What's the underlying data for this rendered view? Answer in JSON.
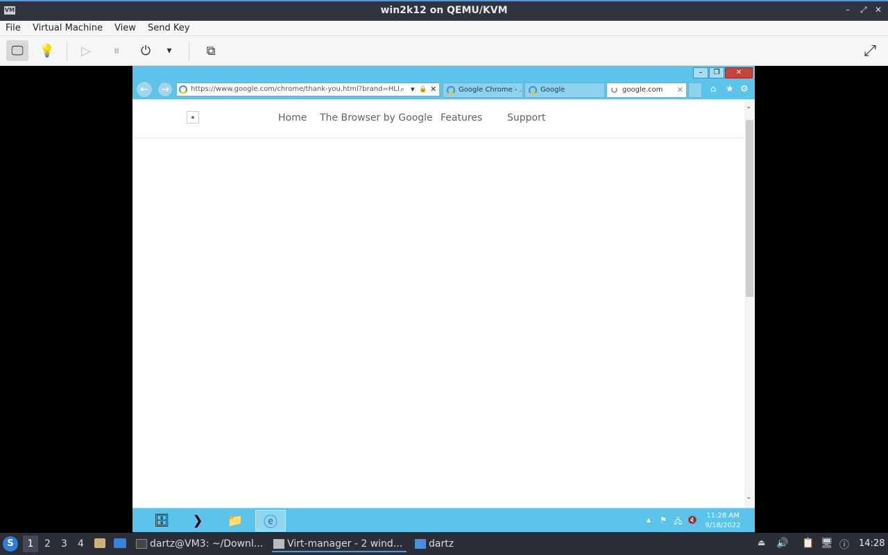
{
  "window": {
    "title": "win2k12 on QEMU/KVM",
    "controls": {
      "minimize": "–",
      "restore": "⤢",
      "close": "✕"
    }
  },
  "menu": {
    "file": "File",
    "vm": "Virtual Machine",
    "view": "View",
    "send_key": "Send Key"
  },
  "toolbar": {
    "console": "🖵",
    "details": "💡",
    "run": "▷",
    "pause": "⏸",
    "power": "⏻",
    "power_menu": "▾",
    "snapshots": "⧉",
    "fullscreen": "⤢"
  },
  "ie": {
    "caption": {
      "minimize": "–",
      "restore": "❐",
      "close": "✕"
    },
    "back": "←",
    "forward": "→",
    "address_url": "https://www.google.com/chrome/thank-you.html?brand=HLDY",
    "address_icons": {
      "search": "⌕",
      "dropdown": "▾",
      "lock": "🔒",
      "stop": "✕"
    },
    "tabs": [
      {
        "label": "Google Chrome - ..."
      },
      {
        "label": "Google"
      },
      {
        "label": "google.com",
        "close": "✕"
      }
    ],
    "right_icons": {
      "home": "⌂",
      "favorites": "★",
      "tools": "⚙"
    }
  },
  "site": {
    "logo": "▪",
    "nav": [
      "Home",
      "The Browser by Google",
      "Features",
      "Support"
    ]
  },
  "scrollbar": {
    "up": "⌃",
    "down": "⌄"
  },
  "win_taskbar": {
    "apps": {
      "server_manager": "🗄",
      "powershell": "❯",
      "explorer": "📁",
      "ie": "ⓔ"
    },
    "tray": {
      "up": "▲",
      "flag": "⚑",
      "network": "🖧",
      "volume": "🔇"
    },
    "time": "11:28 AM",
    "date": "9/18/2022"
  },
  "host_panel": {
    "workspaces": [
      "1",
      "2",
      "3",
      "4"
    ],
    "tasks": [
      {
        "label": "dartz@VM3: ~/Downl..."
      },
      {
        "label": "Virt-manager - 2 wind..."
      },
      {
        "label": "dartz"
      }
    ],
    "time": "14:28",
    "tray": {
      "upload": "⏏",
      "volume": "🔊",
      "clipboard": "📋",
      "display": "🖥",
      "updates": "ⓘ"
    }
  },
  "colors": {
    "ie_frame": "#5cc4ea",
    "host_titlebar": "#2f343f",
    "accent": "#5294e2"
  }
}
